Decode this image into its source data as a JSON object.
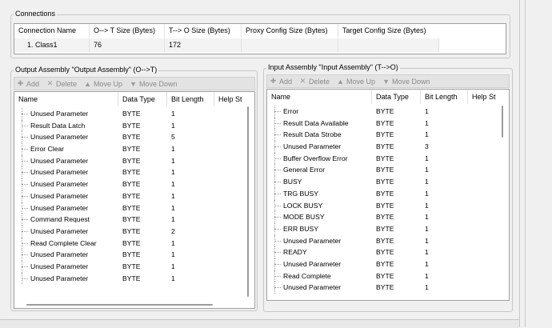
{
  "connections": {
    "title": "Connections",
    "columns": [
      "Connection Name",
      "O--> T Size (Bytes)",
      "T--> O Size (Bytes)",
      "Proxy Config Size (Bytes)",
      "Target Config Size (Bytes)"
    ],
    "rows": [
      {
        "name": "1. Class1",
        "ot": "76",
        "to": "172",
        "proxy": "",
        "target": ""
      }
    ]
  },
  "output": {
    "title": "Output Assembly \"Output Assembly\" (O-->T)",
    "toolbar": {
      "add": "Add",
      "delete": "Delete",
      "move_up": "Move Up",
      "move_down": "Move Down"
    },
    "columns": [
      "Name",
      "Data Type",
      "Bit Length",
      "Help St"
    ],
    "rows": [
      {
        "name": "Unused Parameter",
        "type": "BYTE",
        "bits": "1"
      },
      {
        "name": "Result Data Latch",
        "type": "BYTE",
        "bits": "1"
      },
      {
        "name": "Unused Parameter",
        "type": "BYTE",
        "bits": "5"
      },
      {
        "name": "Error Clear",
        "type": "BYTE",
        "bits": "1"
      },
      {
        "name": "Unused Parameter",
        "type": "BYTE",
        "bits": "1"
      },
      {
        "name": "Unused Parameter",
        "type": "BYTE",
        "bits": "1"
      },
      {
        "name": "Unused Parameter",
        "type": "BYTE",
        "bits": "1"
      },
      {
        "name": "Unused Parameter",
        "type": "BYTE",
        "bits": "1"
      },
      {
        "name": "Unused Parameter",
        "type": "BYTE",
        "bits": "1"
      },
      {
        "name": "Command Request",
        "type": "BYTE",
        "bits": "1"
      },
      {
        "name": "Unused Parameter",
        "type": "BYTE",
        "bits": "2"
      },
      {
        "name": "Read Complete Clear",
        "type": "BYTE",
        "bits": "1"
      },
      {
        "name": "Unused Parameter",
        "type": "BYTE",
        "bits": "1"
      },
      {
        "name": "Unused Parameter",
        "type": "BYTE",
        "bits": "1"
      },
      {
        "name": "Unused Parameter",
        "type": "BYTE",
        "bits": "1"
      }
    ]
  },
  "input": {
    "title": "Input Assembly \"Input Assembly\" (T-->O)",
    "toolbar": {
      "add": "Add",
      "delete": "Delete",
      "move_up": "Move Up",
      "move_down": "Move Down"
    },
    "columns": [
      "Name",
      "Data Type",
      "Bit Length",
      "Help St"
    ],
    "rows": [
      {
        "name": "Error",
        "type": "BYTE",
        "bits": "1"
      },
      {
        "name": "Result Data Available",
        "type": "BYTE",
        "bits": "1"
      },
      {
        "name": "Result Data Strobe",
        "type": "BYTE",
        "bits": "1"
      },
      {
        "name": "Unused Parameter",
        "type": "BYTE",
        "bits": "3"
      },
      {
        "name": "Buffer Overflow Error",
        "type": "BYTE",
        "bits": "1"
      },
      {
        "name": "General Error",
        "type": "BYTE",
        "bits": "1"
      },
      {
        "name": "BUSY",
        "type": "BYTE",
        "bits": "1"
      },
      {
        "name": "TRG BUSY",
        "type": "BYTE",
        "bits": "1"
      },
      {
        "name": "LOCK BUSY",
        "type": "BYTE",
        "bits": "1"
      },
      {
        "name": "MODE BUSY",
        "type": "BYTE",
        "bits": "1"
      },
      {
        "name": "ERR BUSY",
        "type": "BYTE",
        "bits": "1"
      },
      {
        "name": "Unused Parameter",
        "type": "BYTE",
        "bits": "1"
      },
      {
        "name": "READY",
        "type": "BYTE",
        "bits": "1"
      },
      {
        "name": "Unused Parameter",
        "type": "BYTE",
        "bits": "1"
      },
      {
        "name": "Read Complete",
        "type": "BYTE",
        "bits": "1"
      },
      {
        "name": "Unused Parameter",
        "type": "BYTE",
        "bits": "1"
      }
    ]
  },
  "icons": {
    "add": "add-icon",
    "delete": "delete-icon",
    "move_up": "arrow-up-icon",
    "move_down": "arrow-down-icon"
  }
}
